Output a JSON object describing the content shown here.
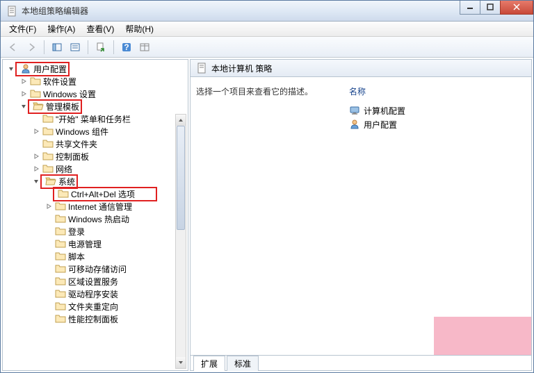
{
  "window": {
    "title": "本地组策略编辑器"
  },
  "menu": {
    "file": "文件(F)",
    "action": "操作(A)",
    "view": "查看(V)",
    "help": "帮助(H)"
  },
  "tree": {
    "root": "用户配置",
    "software": "软件设置",
    "windows_settings": "Windows 设置",
    "admin_templates": "管理模板",
    "start_menu": "\"开始\" 菜单和任务栏",
    "windows_components": "Windows 组件",
    "shared_folders": "共享文件夹",
    "control_panel": "控制面板",
    "network": "网络",
    "system": "系统",
    "ctrl_alt_del": "Ctrl+Alt+Del 选项",
    "internet_comm": "Internet 通信管理",
    "windows_hotstart": "Windows 热启动",
    "logon": "登录",
    "power_mgmt": "电源管理",
    "scripts": "脚本",
    "removable_storage": "可移动存储访问",
    "locale_services": "区域设置服务",
    "driver_install": "驱动程序安装",
    "folder_redirect": "文件夹重定向",
    "perf_cp": "性能控制面板"
  },
  "right": {
    "header": "本地计算机 策略",
    "desc": "选择一个项目来查看它的描述。",
    "col_name": "名称",
    "item_computer": "计算机配置",
    "item_user": "用户配置"
  },
  "tabs": {
    "extended": "扩展",
    "standard": "标准"
  }
}
